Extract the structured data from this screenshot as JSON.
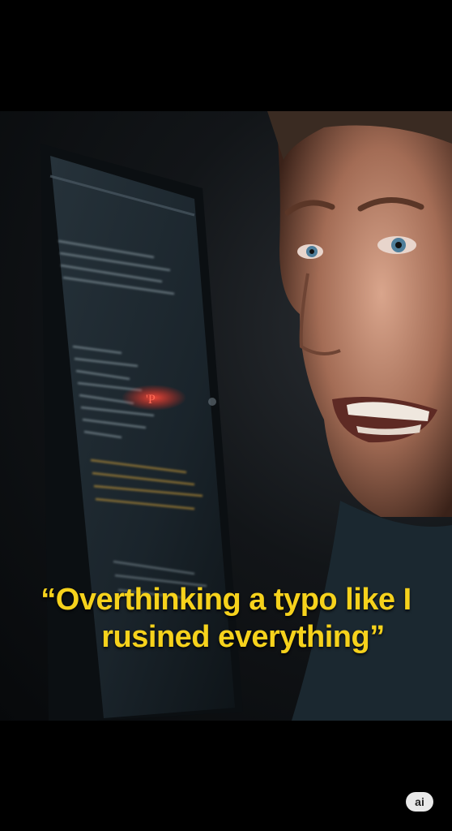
{
  "caption": {
    "line1": "“Overthinking a typo like I",
    "line2": "rusined everything”"
  },
  "badge": {
    "label": "ai"
  },
  "colors": {
    "caption": "#f6d21c",
    "background": "#000000",
    "error_glow": "#ff3a2a"
  },
  "photo": {
    "subject": "distressed woman looking at monitor",
    "screen_error_mark": "'P"
  }
}
